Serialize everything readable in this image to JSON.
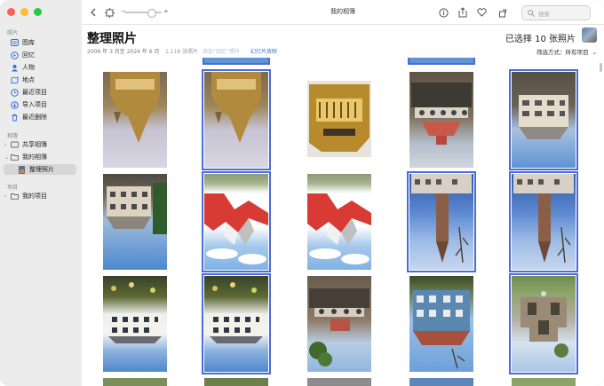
{
  "window": {
    "title": "我的相簿"
  },
  "sidebar": {
    "section_photos": "照片",
    "items": [
      {
        "label": "图库",
        "icon": "library-icon"
      },
      {
        "label": "回忆",
        "icon": "memories-icon"
      },
      {
        "label": "人物",
        "icon": "people-icon"
      },
      {
        "label": "地点",
        "icon": "places-icon"
      },
      {
        "label": "最近项目",
        "icon": "recents-icon"
      },
      {
        "label": "导入项目",
        "icon": "imports-icon"
      },
      {
        "label": "最近删除",
        "icon": "trash-icon"
      }
    ],
    "section_albums": "相簿",
    "shared_albums": "共享相簿",
    "my_albums": "我的相簿",
    "current_album": "整理照片",
    "section_projects": "项目",
    "my_projects": "我的项目"
  },
  "toolbar": {
    "search_placeholder": "搜索",
    "zoom_minus": "−",
    "zoom_plus": "+"
  },
  "header": {
    "title": "整理照片",
    "date_range": "2006 年 3 月至 2024 年 6 月",
    "photo_count": "1,118 张照片",
    "add_to_link": "添加“回忆”照片",
    "slideshow_link": "幻灯片放映",
    "selected_count": "已选择 10 张照片",
    "filter_label": "筛选方式：所有项目"
  },
  "colors": {
    "accent": "#4a6bd8",
    "link": "#3a6fd9"
  },
  "photos": [
    {
      "kind": "gothic-gold",
      "selected": false
    },
    {
      "kind": "gothic-gold",
      "selected": true
    },
    {
      "kind": "gold-facade",
      "selected": false
    },
    {
      "kind": "arcade-red",
      "selected": false
    },
    {
      "kind": "chateau",
      "selected": true
    },
    {
      "kind": "chateau-2",
      "selected": false
    },
    {
      "kind": "red-roofs",
      "selected": true
    },
    {
      "kind": "red-roofs",
      "selected": false
    },
    {
      "kind": "tower-sky",
      "selected": true
    },
    {
      "kind": "tower-sky",
      "selected": true
    },
    {
      "kind": "garden-house",
      "selected": false
    },
    {
      "kind": "garden-house",
      "selected": true
    },
    {
      "kind": "arcade-tree",
      "selected": false
    },
    {
      "kind": "blue-house",
      "selected": false
    },
    {
      "kind": "ruins",
      "selected": true
    }
  ]
}
